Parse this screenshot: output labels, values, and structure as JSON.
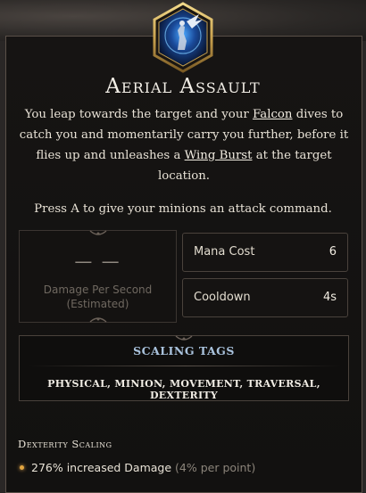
{
  "skill": {
    "title": "Aerial Assault",
    "desc_parts": {
      "p1": "You leap towards the target and your ",
      "kw1": "Falcon",
      "p2": " dives to catch you and momentarily carry you further, before it flies up and unleashes a ",
      "kw2": "Wing Burst",
      "p3": " at the target location."
    },
    "press_hint": "Press A to give your minions an attack command.",
    "icon": "falcon-rider-icon"
  },
  "stats": {
    "dps_value": "— —",
    "dps_label_1": "Damage Per Second",
    "dps_label_2": "(Estimated)",
    "mana_label": "Mana Cost",
    "mana_value": "6",
    "cooldown_label": "Cooldown",
    "cooldown_value": "4s"
  },
  "tags": {
    "title": "SCALING TAGS",
    "list": "PHYSICAL, MINION, MOVEMENT, TRAVERSAL, DEXTERITY"
  },
  "scaling": {
    "title": "Dexterity Scaling",
    "line_main": "276% increased Damage ",
    "line_muted": "(4% per point)"
  },
  "colors": {
    "accent_blue": "#a9c2dc",
    "bullet_gold": "#e2a540",
    "panel_border": "#5a5048"
  }
}
